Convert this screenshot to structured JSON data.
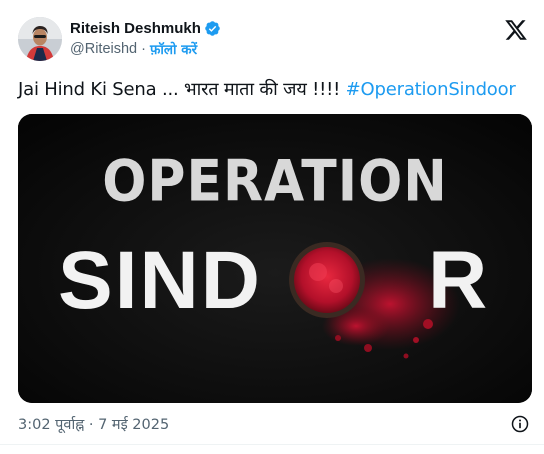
{
  "post": {
    "author": {
      "display_name": "Riteish Deshmukh",
      "handle": "@Riteishd",
      "separator": "·",
      "follow_label": "फ़ॉलो करें",
      "verified": true
    },
    "text": "Jai Hind Ki Sena ... भारत माता की जय !!!! ",
    "hashtag": "#OperationSindoor",
    "media": {
      "line1": "OPERATION",
      "line2_left": "SIND",
      "line2_right": "R"
    },
    "timestamp": "3:02 पूर्वाह्न · 7 मई 2025"
  },
  "colors": {
    "accent": "#1d9bf0",
    "text": "#0f1419",
    "muted": "#536471",
    "sindoor_red": "#c8102e"
  },
  "icons": [
    "verified-badge-icon",
    "x-logo-icon",
    "info-icon"
  ]
}
